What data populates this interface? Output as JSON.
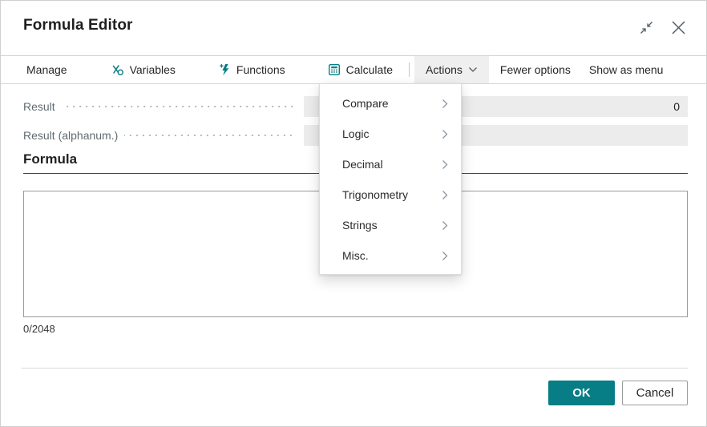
{
  "window": {
    "title": "Formula Editor",
    "controls": {
      "collapse_icon": "collapse-window-icon",
      "close_icon": "close-icon"
    }
  },
  "toolbar": {
    "manage_label": "Manage",
    "variables_label": "Variables",
    "functions_label": "Functions",
    "calculate_label": "Calculate",
    "actions_label": "Actions",
    "fewer_options_label": "Fewer options",
    "show_as_menu_label": "Show as menu",
    "icons": {
      "variables": "variable-x-icon",
      "functions": "lightning-function-icon",
      "calculate": "calculator-icon",
      "actions_chevron": "chevron-down-icon"
    }
  },
  "fields": {
    "result": {
      "label": "Result",
      "value": "0"
    },
    "result_alphanum": {
      "label": "Result (alphanum.)",
      "value": ""
    }
  },
  "formula_section": {
    "heading": "Formula",
    "textarea_value": "",
    "counter": "0/2048"
  },
  "actions_menu": {
    "items": [
      {
        "label": "Compare",
        "submenu_icon": "chevron-right-icon"
      },
      {
        "label": "Logic",
        "submenu_icon": "chevron-right-icon"
      },
      {
        "label": "Decimal",
        "submenu_icon": "chevron-right-icon"
      },
      {
        "label": "Trigonometry",
        "submenu_icon": "chevron-right-icon"
      },
      {
        "label": "Strings",
        "submenu_icon": "chevron-right-icon"
      },
      {
        "label": "Misc.",
        "submenu_icon": "chevron-right-icon"
      }
    ]
  },
  "footer": {
    "ok_label": "OK",
    "cancel_label": "Cancel"
  },
  "colors": {
    "accent_teal": "#077d85",
    "field_background": "#ececec",
    "label_gray": "#5f6b70",
    "menu_border": "#dcdcdc"
  }
}
